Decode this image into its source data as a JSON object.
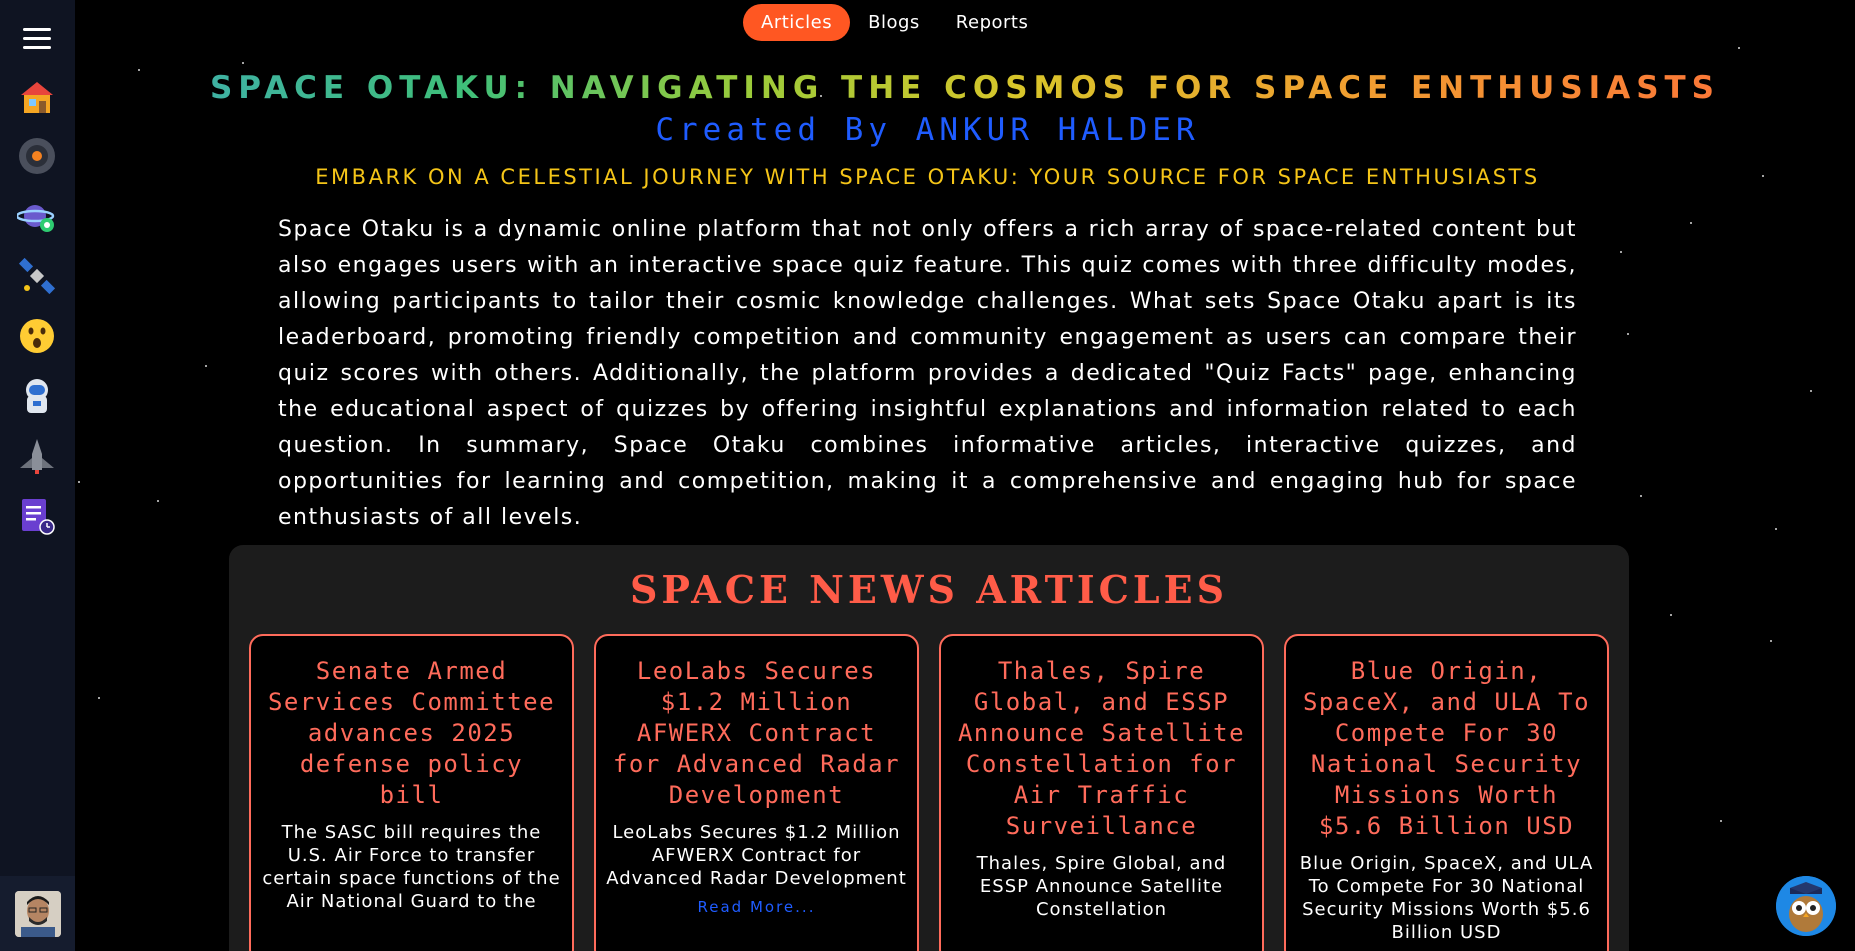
{
  "nav": {
    "items": [
      {
        "label": "Articles",
        "active": true
      },
      {
        "label": "Blogs",
        "active": false
      },
      {
        "label": "Reports",
        "active": false
      }
    ]
  },
  "sidebar": {
    "icons": [
      "home-icon",
      "space-station-icon",
      "planet-icon",
      "satellite-icon",
      "surprised-face-icon",
      "astronaut-icon",
      "spaceship-icon",
      "quiz-document-icon"
    ]
  },
  "hero": {
    "title": "SPACE OTAKU: NAVIGATING THE COSMOS FOR SPACE ENTHUSIASTS",
    "creator": "Created By ANKUR HALDER",
    "tagline": "EMBARK ON A CELESTIAL JOURNEY WITH SPACE OTAKU: YOUR SOURCE FOR SPACE ENTHUSIASTS",
    "intro": "Space Otaku is a dynamic online platform that not only offers a rich array of space-related content but also engages users with an interactive space quiz feature. This quiz comes with three difficulty modes, allowing participants to tailor their cosmic knowledge challenges. What sets Space Otaku apart is its leaderboard, promoting friendly competition and community engagement as users can compare their quiz scores with others. Additionally, the platform provides a dedicated \"Quiz Facts\" page, enhancing the educational aspect of quizzes by offering insightful explanations and information related to each question. In summary, Space Otaku combines informative articles, interactive quizzes, and opportunities for learning and competition, making it a comprehensive and engaging hub for space enthusiasts of all levels."
  },
  "news": {
    "heading": "SPACE NEWS ARTICLES",
    "cards": [
      {
        "title": "Senate Armed Services Committee advances 2025 defense policy bill",
        "desc": "The SASC bill requires the U.S. Air Force to transfer certain space functions of the Air National Guard to the",
        "read_more": ""
      },
      {
        "title": "LeoLabs Secures $1.2 Million AFWERX Contract for Advanced Radar Development",
        "desc": "LeoLabs Secures $1.2 Million AFWERX Contract for Advanced Radar Development",
        "read_more": "Read More..."
      },
      {
        "title": "Thales, Spire Global, and ESSP Announce Satellite Constellation for Air Traffic Surveillance",
        "desc": "Thales, Spire Global, and ESSP Announce Satellite Constellation",
        "read_more": ""
      },
      {
        "title": "Blue Origin, SpaceX, and ULA To Compete For 30 National Security Missions Worth $5.6 Billion USD",
        "desc": "Blue Origin, SpaceX, and ULA To Compete For 30 National Security Missions Worth $5.6 Billion USD",
        "read_more": ""
      }
    ]
  },
  "colors": {
    "accent": "#ff5722",
    "card_border": "#ff6b5b",
    "creator": "#1f5cff",
    "tagline": "#f5c518",
    "sidebar_bg": "#0f1422"
  }
}
